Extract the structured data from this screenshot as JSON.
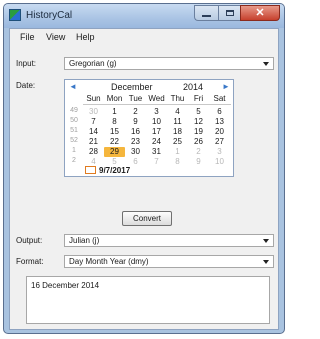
{
  "window": {
    "title": "HistoryCal"
  },
  "menu": [
    "File",
    "View",
    "Help"
  ],
  "input": {
    "label": "Input:",
    "value": "Gregorian (g)"
  },
  "date_label": "Date:",
  "calendar": {
    "prev": "◄",
    "next": "►",
    "month": "December",
    "year": "2014",
    "weekdays": [
      "Sun",
      "Mon",
      "Tue",
      "Wed",
      "Thu",
      "Fri",
      "Sat"
    ],
    "weeks": [
      {
        "num": "49",
        "days": [
          "30",
          "1",
          "2",
          "3",
          "4",
          "5",
          "6"
        ]
      },
      {
        "num": "50",
        "days": [
          "7",
          "8",
          "9",
          "10",
          "11",
          "12",
          "13"
        ]
      },
      {
        "num": "51",
        "days": [
          "14",
          "15",
          "16",
          "17",
          "18",
          "19",
          "20"
        ]
      },
      {
        "num": "52",
        "days": [
          "21",
          "22",
          "23",
          "24",
          "25",
          "26",
          "27"
        ]
      },
      {
        "num": "1",
        "days": [
          "28",
          "29",
          "30",
          "31",
          "1",
          "2",
          "3"
        ]
      },
      {
        "num": "2",
        "days": [
          "4",
          "5",
          "6",
          "7",
          "8",
          "9",
          "10"
        ]
      }
    ],
    "selected": "29",
    "today": "9/7/2017"
  },
  "convert_label": "Convert",
  "output": {
    "label": "Output:",
    "value": "Julian (j)"
  },
  "format": {
    "label": "Format:",
    "value": "Day Month Year (dmy)"
  },
  "result": "16 December 2014",
  "colors": {
    "selection": "#f5b63d",
    "accent": "#3a78c8",
    "titlebar": "#aac4e4",
    "close": "#c6402d"
  }
}
